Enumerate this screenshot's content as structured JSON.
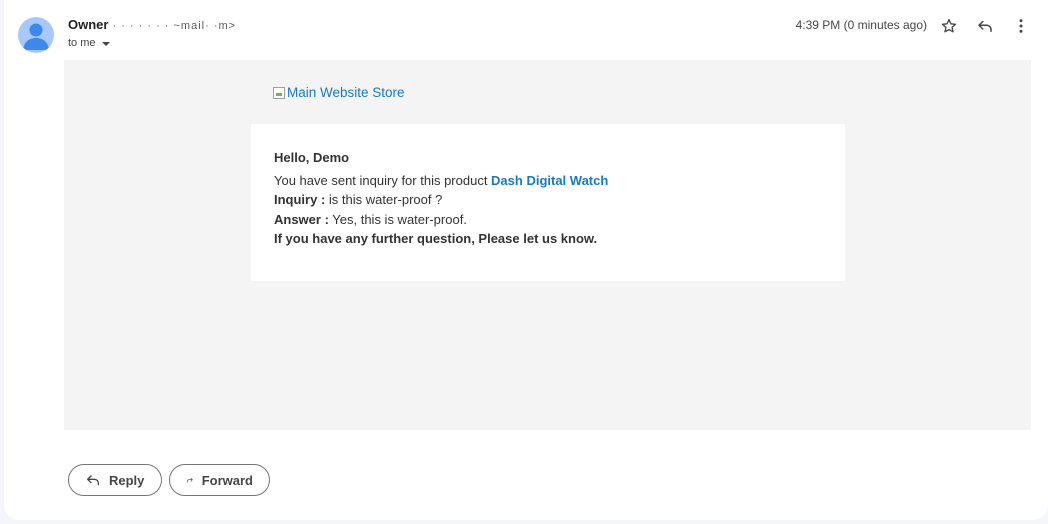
{
  "header": {
    "sender_name": "Owner",
    "sender_email": "·  ·  · ·   ·    ·  ·  ~mail·  ·m>",
    "recipient": "to me",
    "timestamp": "4:39 PM (0 minutes ago)",
    "icons": [
      "avatar-icon",
      "star-icon",
      "reply-icon",
      "more-vert-icon"
    ]
  },
  "email": {
    "logo_alt": "Main Website Store",
    "greeting": "Hello, Demo",
    "intro_text": "You have sent inquiry for this product ",
    "product_name": "Dash Digital Watch",
    "inquiry_label": "Inquiry :",
    "inquiry_text": " is this water-proof ?",
    "answer_label": "Answer :",
    "answer_text": " Yes, this is water-proof.",
    "closing": "If you have any further question, Please let us know."
  },
  "actions": {
    "reply_label": "Reply",
    "forward_label": "Forward"
  },
  "colors": {
    "link": "#1979c3",
    "body_bg": "#f4f4f4",
    "avatar": "#a8c7fa"
  }
}
